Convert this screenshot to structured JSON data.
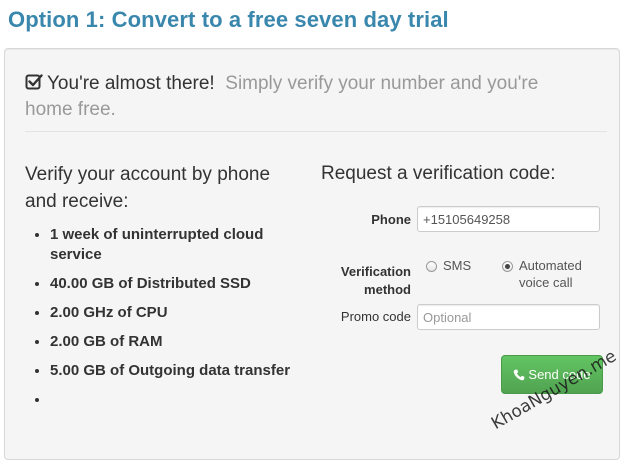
{
  "page": {
    "title": "Option 1: Convert to a free seven day trial"
  },
  "notice": {
    "icon": "checkbox-check-icon",
    "title": "You're almost there!",
    "subtitle": "Simply verify your number and you're home free."
  },
  "benefits": {
    "heading": "Verify your account by phone and receive:",
    "items": [
      "1 week of uninterrupted cloud service",
      "40.00 GB of Distributed SSD",
      "2.00 GHz of CPU",
      "2.00 GB of RAM",
      "5.00 GB of Outgoing data transfer",
      ""
    ]
  },
  "form": {
    "heading": "Request a verification code:",
    "phone_label": "Phone",
    "phone_value": "+15105649258",
    "method_label_line1": "Verification",
    "method_label_line2": "method",
    "method_options": [
      {
        "label": "SMS",
        "selected": false
      },
      {
        "label": "Automated voice call",
        "selected": true
      }
    ],
    "promo_label": "Promo code",
    "promo_placeholder": "Optional",
    "send_button_label": "Send code",
    "send_button_icon": "phone-icon"
  },
  "watermark": {
    "text": "KhoaNguyen.me"
  },
  "colors": {
    "title": "#3a87ad",
    "panel_bg": "#f5f5f5",
    "button_green": "#5bb75b",
    "muted_text": "#999999"
  }
}
